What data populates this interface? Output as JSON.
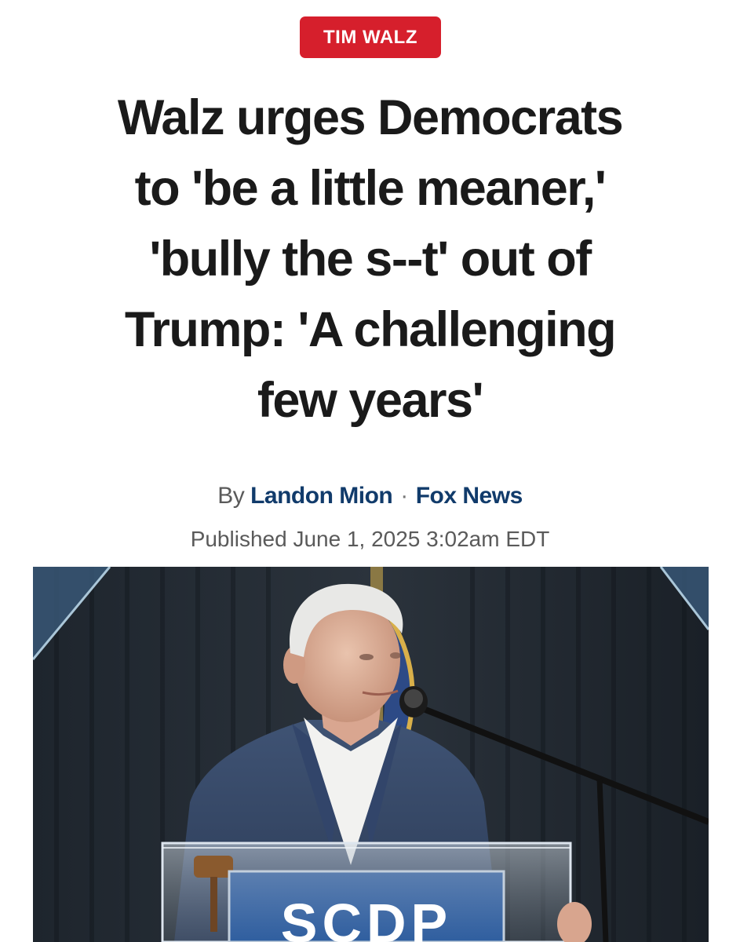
{
  "article": {
    "tag": "TIM WALZ",
    "headline_lines": [
      "Walz urges Democrats",
      "to 'be a little meaner,'",
      "'bully the s--t' out of",
      "Trump: 'A challenging",
      "few years'"
    ],
    "byline": {
      "prefix": "By",
      "author": "Landon Mion",
      "separator": "·",
      "outlet": "Fox News"
    },
    "published": "Published June 1, 2025 3:02am EDT"
  },
  "photo": {
    "podium_sign_text": "SCDP"
  },
  "colors": {
    "tag_background": "#d61f2c",
    "author_link": "#113b6b",
    "headline": "#1a1a1a",
    "meta_text": "#5a5a5a"
  }
}
